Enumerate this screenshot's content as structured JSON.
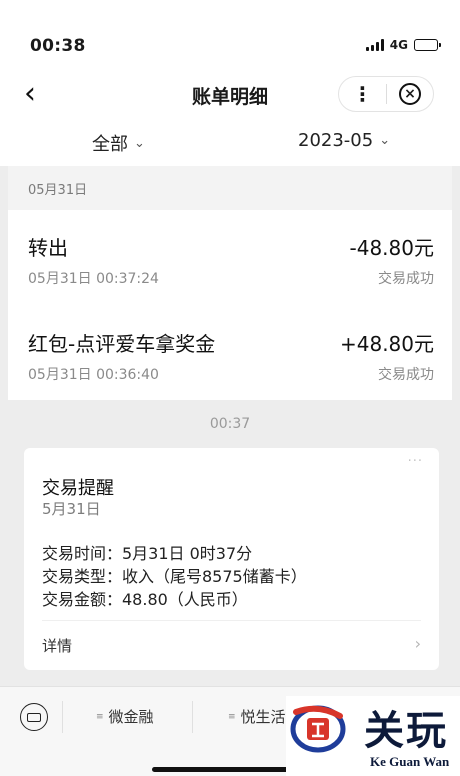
{
  "status": {
    "time": "00:38",
    "network": "4G"
  },
  "nav": {
    "title": "账单明细",
    "back_icon": "chevron-left-icon",
    "more_label": "⋮",
    "close_label": "×"
  },
  "filter": {
    "category": "全部",
    "month": "2023-05"
  },
  "group": {
    "date": "05月31日"
  },
  "transactions": [
    {
      "title": "转出",
      "amount": "-48.80元",
      "time": "05月31日 00:37:24",
      "status": "交易成功"
    },
    {
      "title": "红包-点评爱车拿奖金",
      "amount": "+48.80元",
      "time": "05月31日 00:36:40",
      "status": "交易成功"
    }
  ],
  "chat": {
    "time": "00:37",
    "card": {
      "dots": "···",
      "title": "交易提醒",
      "date": "5月31日",
      "lines": [
        "交易时间：5月31日 0时37分",
        "交易类型：收入（尾号8575储蓄卡）",
        "交易金额：48.80（人民币）"
      ],
      "detail": "详情"
    }
  },
  "bottom_menu": {
    "items": [
      "微金融",
      "悦生活"
    ]
  },
  "watermark": {
    "cn": "关玩",
    "en": "Ke Guan Wan"
  },
  "colors": {
    "battery": "#4cd964",
    "text": "#1a1a1a",
    "muted": "#8a8a8a",
    "background": "#ededed",
    "watermark": "#0d1a3a"
  }
}
